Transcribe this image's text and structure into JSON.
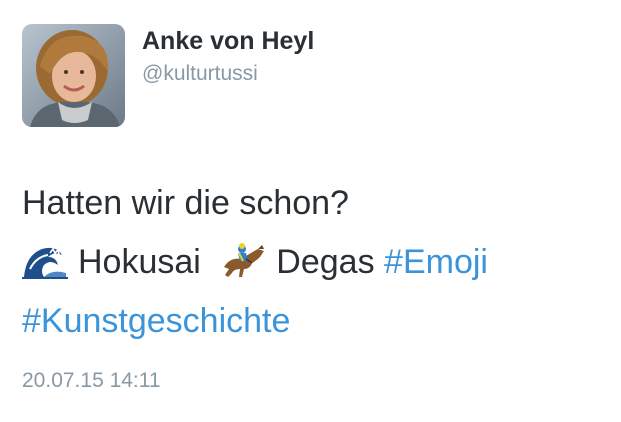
{
  "author": {
    "name": "Anke von Heyl",
    "handle": "@kulturtussi",
    "avatar_icon": "profile-photo"
  },
  "tweet": {
    "line1": "Hatten wir die schon?",
    "emoji_wave": "water-wave-icon",
    "word_hokusai": "Hokusai",
    "emoji_horse": "horse-racing-icon",
    "word_degas": "Degas",
    "hashtag_emoji": "#Emoji",
    "hashtag_kunst": "#Kunstgeschichte"
  },
  "timestamp": "20.07.15 14:11",
  "colors": {
    "text": "#292f33",
    "secondary": "#8899a6",
    "link": "#3b94d9"
  }
}
